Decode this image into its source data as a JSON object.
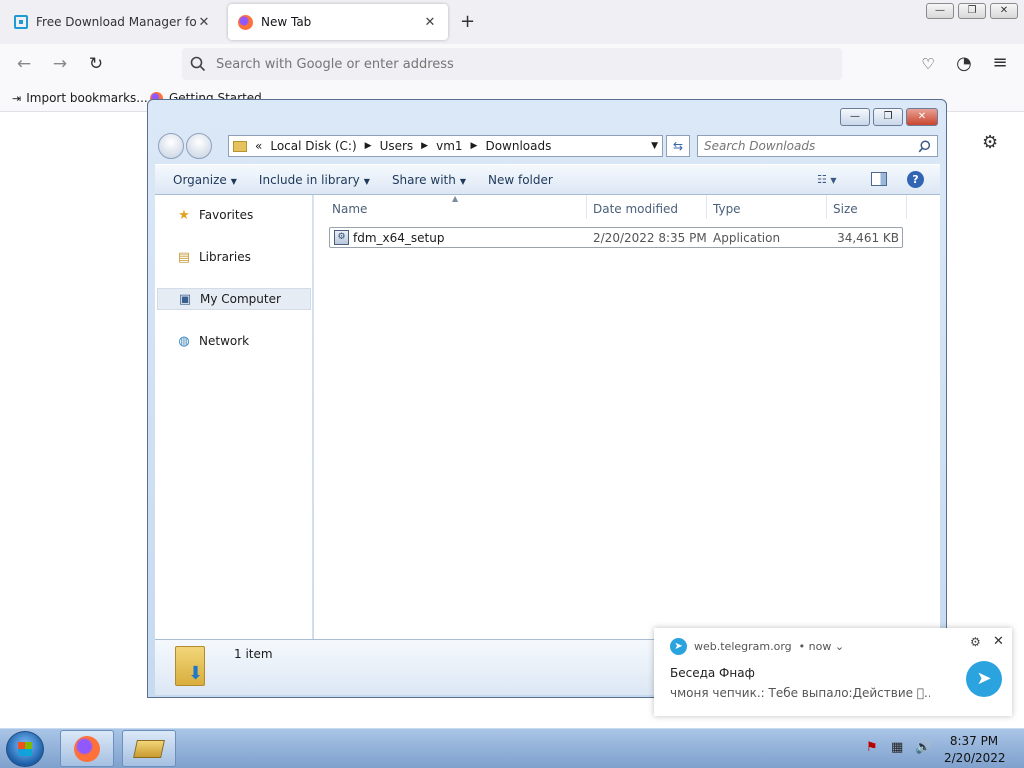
{
  "browser": {
    "tabs": [
      {
        "title": "Free Download Manager for Wi",
        "close": "✕"
      },
      {
        "title": "New Tab",
        "close": "✕"
      }
    ],
    "new_tab": "+",
    "window_controls": {
      "minimize": "—",
      "restore": "❐",
      "close": "✕"
    },
    "nav": {
      "back": "←",
      "forward": "→",
      "reload": "↻"
    },
    "url_placeholder": "Search with Google or enter address",
    "toolbar_icons": {
      "pocket": "♡",
      "account": "◔",
      "menu": "≡"
    },
    "bookmarks": [
      {
        "label": "Import bookmarks..."
      },
      {
        "label": "Getting Started"
      }
    ],
    "settings_icon": "⚙"
  },
  "explorer": {
    "window_controls": {
      "minimize": "—",
      "restore": "❐",
      "close": "✕"
    },
    "address": {
      "overflow": "«",
      "crumbs": [
        "Local Disk (C:)",
        "Users",
        "vm1",
        "Downloads"
      ],
      "separator": "▶",
      "dropdown": "▼",
      "refresh": "⇆"
    },
    "search_placeholder": "Search Downloads",
    "toolbar": {
      "organize": "Organize",
      "include_in_library": "Include in library",
      "share_with": "Share with",
      "new_folder": "New folder",
      "arrow": "▼"
    },
    "nav_items": [
      {
        "label": "Favorites",
        "icon": "★"
      },
      {
        "label": "Libraries",
        "icon": "▤"
      },
      {
        "label": "My Computer",
        "icon": "▣"
      },
      {
        "label": "Network",
        "icon": "◍"
      }
    ],
    "columns": {
      "name": "Name",
      "date_modified": "Date modified",
      "type": "Type",
      "size": "Size"
    },
    "files": [
      {
        "name": "fdm_x64_setup",
        "date": "2/20/2022 8:35 PM",
        "type": "Application",
        "size": "34,461 KB"
      }
    ],
    "status": "1 item"
  },
  "notification": {
    "source": "web.telegram.org",
    "time": "• now ⌄",
    "title": "Беседа Фнаф",
    "body": "чмоня чепчик.: Тебе выпало:Действие 🏿...",
    "settings": "⚙",
    "close": "✕"
  },
  "taskbar": {
    "time": "8:37 PM",
    "date": "2/20/2022"
  }
}
